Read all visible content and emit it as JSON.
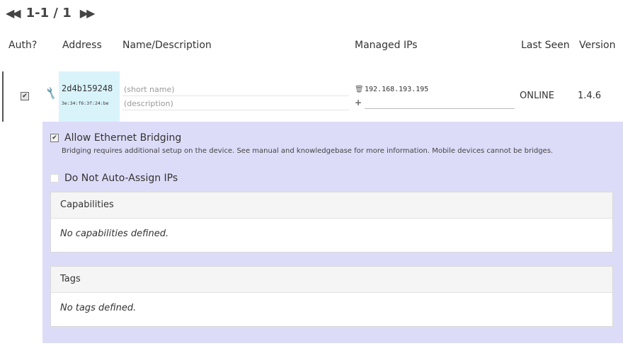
{
  "pager": {
    "prev_icon": "double-chevron-left-icon",
    "text": "1-1 / 1",
    "next_icon": "double-chevron-right-icon"
  },
  "columns": {
    "auth": "Auth?",
    "address": "Address",
    "name": "Name/Description",
    "managed_ips": "Managed IPs",
    "last_seen": "Last Seen",
    "version": "Version"
  },
  "member": {
    "authorized": true,
    "address": "2d4b159248",
    "mac": "3e:34:f6:3f:24:be",
    "name_value": "",
    "name_placeholder": "(short name)",
    "description_value": "",
    "description_placeholder": "(description)",
    "managed_ips": [
      "192.168.193.195"
    ],
    "last_seen": "ONLINE",
    "version": "1.4.6"
  },
  "details": {
    "allow_bridging": {
      "checked": true,
      "label": "Allow Ethernet Bridging",
      "note": "Bridging requires additional setup on the device. See manual and knowledgebase for more information. Mobile devices cannot be bridges."
    },
    "no_auto_assign": {
      "checked": false,
      "label": "Do Not Auto-Assign IPs"
    },
    "capabilities": {
      "title": "Capabilities",
      "empty_text": "No capabilities defined."
    },
    "tags": {
      "title": "Tags",
      "empty_text": "No tags defined."
    }
  },
  "colors": {
    "address_highlight": "#d9f3fb",
    "detail_background": "#dddcf8"
  }
}
